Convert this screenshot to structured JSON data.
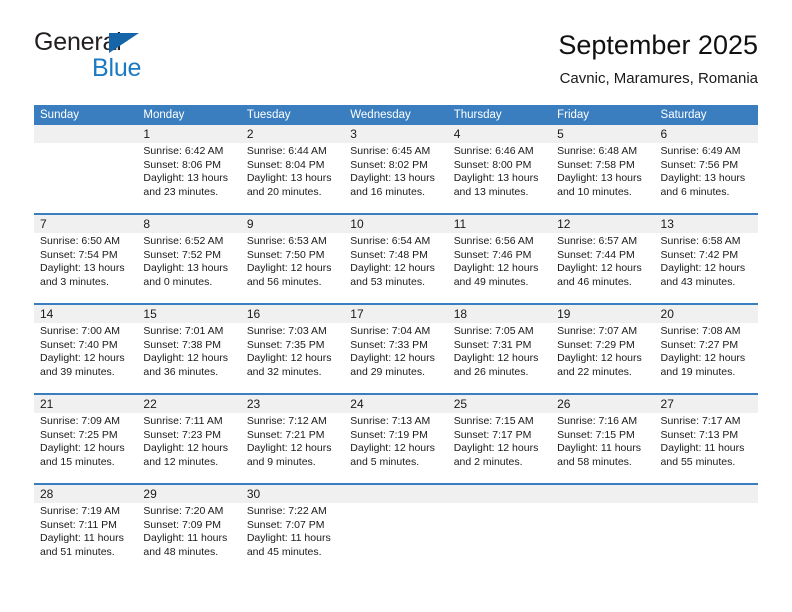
{
  "brand": {
    "name_top": "General",
    "name_bottom": "Blue",
    "triangle_icon": "triangle-icon",
    "color_dark": "#231f20",
    "color_blue": "#1a7ac4"
  },
  "header": {
    "title": "September 2025",
    "subtitle": "Cavnic, Maramures, Romania"
  },
  "theme": {
    "header_blue": "#3a7ebf",
    "day_band_gray": "#f0f0f0",
    "text": "#1a1a1a"
  },
  "calendar": {
    "weekdays": [
      "Sunday",
      "Monday",
      "Tuesday",
      "Wednesday",
      "Thursday",
      "Friday",
      "Saturday"
    ],
    "weeks": [
      [
        {
          "day": "",
          "sunrise": "",
          "sunset": "",
          "daylight": "",
          "daylight2": ""
        },
        {
          "day": "1",
          "sunrise": "Sunrise: 6:42 AM",
          "sunset": "Sunset: 8:06 PM",
          "daylight": "Daylight: 13 hours",
          "daylight2": "and 23 minutes."
        },
        {
          "day": "2",
          "sunrise": "Sunrise: 6:44 AM",
          "sunset": "Sunset: 8:04 PM",
          "daylight": "Daylight: 13 hours",
          "daylight2": "and 20 minutes."
        },
        {
          "day": "3",
          "sunrise": "Sunrise: 6:45 AM",
          "sunset": "Sunset: 8:02 PM",
          "daylight": "Daylight: 13 hours",
          "daylight2": "and 16 minutes."
        },
        {
          "day": "4",
          "sunrise": "Sunrise: 6:46 AM",
          "sunset": "Sunset: 8:00 PM",
          "daylight": "Daylight: 13 hours",
          "daylight2": "and 13 minutes."
        },
        {
          "day": "5",
          "sunrise": "Sunrise: 6:48 AM",
          "sunset": "Sunset: 7:58 PM",
          "daylight": "Daylight: 13 hours",
          "daylight2": "and 10 minutes."
        },
        {
          "day": "6",
          "sunrise": "Sunrise: 6:49 AM",
          "sunset": "Sunset: 7:56 PM",
          "daylight": "Daylight: 13 hours",
          "daylight2": "and 6 minutes."
        }
      ],
      [
        {
          "day": "7",
          "sunrise": "Sunrise: 6:50 AM",
          "sunset": "Sunset: 7:54 PM",
          "daylight": "Daylight: 13 hours",
          "daylight2": "and 3 minutes."
        },
        {
          "day": "8",
          "sunrise": "Sunrise: 6:52 AM",
          "sunset": "Sunset: 7:52 PM",
          "daylight": "Daylight: 13 hours",
          "daylight2": "and 0 minutes."
        },
        {
          "day": "9",
          "sunrise": "Sunrise: 6:53 AM",
          "sunset": "Sunset: 7:50 PM",
          "daylight": "Daylight: 12 hours",
          "daylight2": "and 56 minutes."
        },
        {
          "day": "10",
          "sunrise": "Sunrise: 6:54 AM",
          "sunset": "Sunset: 7:48 PM",
          "daylight": "Daylight: 12 hours",
          "daylight2": "and 53 minutes."
        },
        {
          "day": "11",
          "sunrise": "Sunrise: 6:56 AM",
          "sunset": "Sunset: 7:46 PM",
          "daylight": "Daylight: 12 hours",
          "daylight2": "and 49 minutes."
        },
        {
          "day": "12",
          "sunrise": "Sunrise: 6:57 AM",
          "sunset": "Sunset: 7:44 PM",
          "daylight": "Daylight: 12 hours",
          "daylight2": "and 46 minutes."
        },
        {
          "day": "13",
          "sunrise": "Sunrise: 6:58 AM",
          "sunset": "Sunset: 7:42 PM",
          "daylight": "Daylight: 12 hours",
          "daylight2": "and 43 minutes."
        }
      ],
      [
        {
          "day": "14",
          "sunrise": "Sunrise: 7:00 AM",
          "sunset": "Sunset: 7:40 PM",
          "daylight": "Daylight: 12 hours",
          "daylight2": "and 39 minutes."
        },
        {
          "day": "15",
          "sunrise": "Sunrise: 7:01 AM",
          "sunset": "Sunset: 7:38 PM",
          "daylight": "Daylight: 12 hours",
          "daylight2": "and 36 minutes."
        },
        {
          "day": "16",
          "sunrise": "Sunrise: 7:03 AM",
          "sunset": "Sunset: 7:35 PM",
          "daylight": "Daylight: 12 hours",
          "daylight2": "and 32 minutes."
        },
        {
          "day": "17",
          "sunrise": "Sunrise: 7:04 AM",
          "sunset": "Sunset: 7:33 PM",
          "daylight": "Daylight: 12 hours",
          "daylight2": "and 29 minutes."
        },
        {
          "day": "18",
          "sunrise": "Sunrise: 7:05 AM",
          "sunset": "Sunset: 7:31 PM",
          "daylight": "Daylight: 12 hours",
          "daylight2": "and 26 minutes."
        },
        {
          "day": "19",
          "sunrise": "Sunrise: 7:07 AM",
          "sunset": "Sunset: 7:29 PM",
          "daylight": "Daylight: 12 hours",
          "daylight2": "and 22 minutes."
        },
        {
          "day": "20",
          "sunrise": "Sunrise: 7:08 AM",
          "sunset": "Sunset: 7:27 PM",
          "daylight": "Daylight: 12 hours",
          "daylight2": "and 19 minutes."
        }
      ],
      [
        {
          "day": "21",
          "sunrise": "Sunrise: 7:09 AM",
          "sunset": "Sunset: 7:25 PM",
          "daylight": "Daylight: 12 hours",
          "daylight2": "and 15 minutes."
        },
        {
          "day": "22",
          "sunrise": "Sunrise: 7:11 AM",
          "sunset": "Sunset: 7:23 PM",
          "daylight": "Daylight: 12 hours",
          "daylight2": "and 12 minutes."
        },
        {
          "day": "23",
          "sunrise": "Sunrise: 7:12 AM",
          "sunset": "Sunset: 7:21 PM",
          "daylight": "Daylight: 12 hours",
          "daylight2": "and 9 minutes."
        },
        {
          "day": "24",
          "sunrise": "Sunrise: 7:13 AM",
          "sunset": "Sunset: 7:19 PM",
          "daylight": "Daylight: 12 hours",
          "daylight2": "and 5 minutes."
        },
        {
          "day": "25",
          "sunrise": "Sunrise: 7:15 AM",
          "sunset": "Sunset: 7:17 PM",
          "daylight": "Daylight: 12 hours",
          "daylight2": "and 2 minutes."
        },
        {
          "day": "26",
          "sunrise": "Sunrise: 7:16 AM",
          "sunset": "Sunset: 7:15 PM",
          "daylight": "Daylight: 11 hours",
          "daylight2": "and 58 minutes."
        },
        {
          "day": "27",
          "sunrise": "Sunrise: 7:17 AM",
          "sunset": "Sunset: 7:13 PM",
          "daylight": "Daylight: 11 hours",
          "daylight2": "and 55 minutes."
        }
      ],
      [
        {
          "day": "28",
          "sunrise": "Sunrise: 7:19 AM",
          "sunset": "Sunset: 7:11 PM",
          "daylight": "Daylight: 11 hours",
          "daylight2": "and 51 minutes."
        },
        {
          "day": "29",
          "sunrise": "Sunrise: 7:20 AM",
          "sunset": "Sunset: 7:09 PM",
          "daylight": "Daylight: 11 hours",
          "daylight2": "and 48 minutes."
        },
        {
          "day": "30",
          "sunrise": "Sunrise: 7:22 AM",
          "sunset": "Sunset: 7:07 PM",
          "daylight": "Daylight: 11 hours",
          "daylight2": "and 45 minutes."
        },
        {
          "day": "",
          "sunrise": "",
          "sunset": "",
          "daylight": "",
          "daylight2": ""
        },
        {
          "day": "",
          "sunrise": "",
          "sunset": "",
          "daylight": "",
          "daylight2": ""
        },
        {
          "day": "",
          "sunrise": "",
          "sunset": "",
          "daylight": "",
          "daylight2": ""
        },
        {
          "day": "",
          "sunrise": "",
          "sunset": "",
          "daylight": "",
          "daylight2": ""
        }
      ]
    ]
  }
}
